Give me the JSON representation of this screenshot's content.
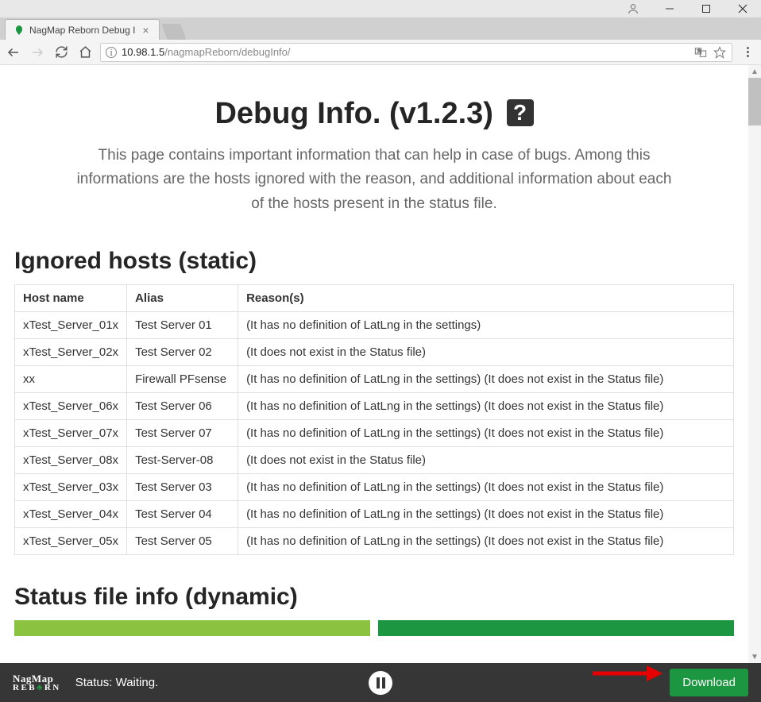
{
  "window": {
    "tab_title": "NagMap Reborn Debug I",
    "url_host": "10.98.1.5",
    "url_path": "/nagmapReborn/debugInfo/"
  },
  "page": {
    "title_prefix": "Debug Info. ",
    "title_version": "(v1.2.3)",
    "help_icon": "?",
    "description": "This page contains important information that can help in case of bugs. Among this informations are the hosts ignored with the reason, and additional information about each of the hosts present in the status file.",
    "section_ignored": "Ignored hosts (static)",
    "section_status": "Status file info (dynamic)",
    "columns": {
      "host": "Host name",
      "alias": "Alias",
      "reason": "Reason(s)"
    },
    "rows": [
      {
        "host": "xTest_Server_01x",
        "alias": "Test Server 01",
        "reason": "(It has no definition of LatLng in the settings)"
      },
      {
        "host": "xTest_Server_02x",
        "alias": "Test Server 02",
        "reason": "(It does not exist in the Status file)"
      },
      {
        "host": "xx",
        "alias": "Firewall PFsense",
        "reason": "(It has no definition of LatLng in the settings) (It does not exist in the Status file)"
      },
      {
        "host": "xTest_Server_06x",
        "alias": "Test Server 06",
        "reason": "(It has no definition of LatLng in the settings) (It does not exist in the Status file)"
      },
      {
        "host": "xTest_Server_07x",
        "alias": "Test Server 07",
        "reason": "(It has no definition of LatLng in the settings) (It does not exist in the Status file)"
      },
      {
        "host": "xTest_Server_08x",
        "alias": "Test-Server-08",
        "reason": "(It does not exist in the Status file)"
      },
      {
        "host": "xTest_Server_03x",
        "alias": "Test Server 03",
        "reason": "(It has no definition of LatLng in the settings) (It does not exist in the Status file)"
      },
      {
        "host": "xTest_Server_04x",
        "alias": "Test Server 04",
        "reason": "(It has no definition of LatLng in the settings) (It does not exist in the Status file)"
      },
      {
        "host": "xTest_Server_05x",
        "alias": "Test Server 05",
        "reason": "(It has no definition of LatLng in the settings) (It does not exist in the Status file)"
      }
    ]
  },
  "footer": {
    "logo_top": "NagMap",
    "logo_bot_pre": "REB",
    "logo_bot_post": "RN",
    "status": "Status: Waiting.",
    "download": "Download"
  }
}
